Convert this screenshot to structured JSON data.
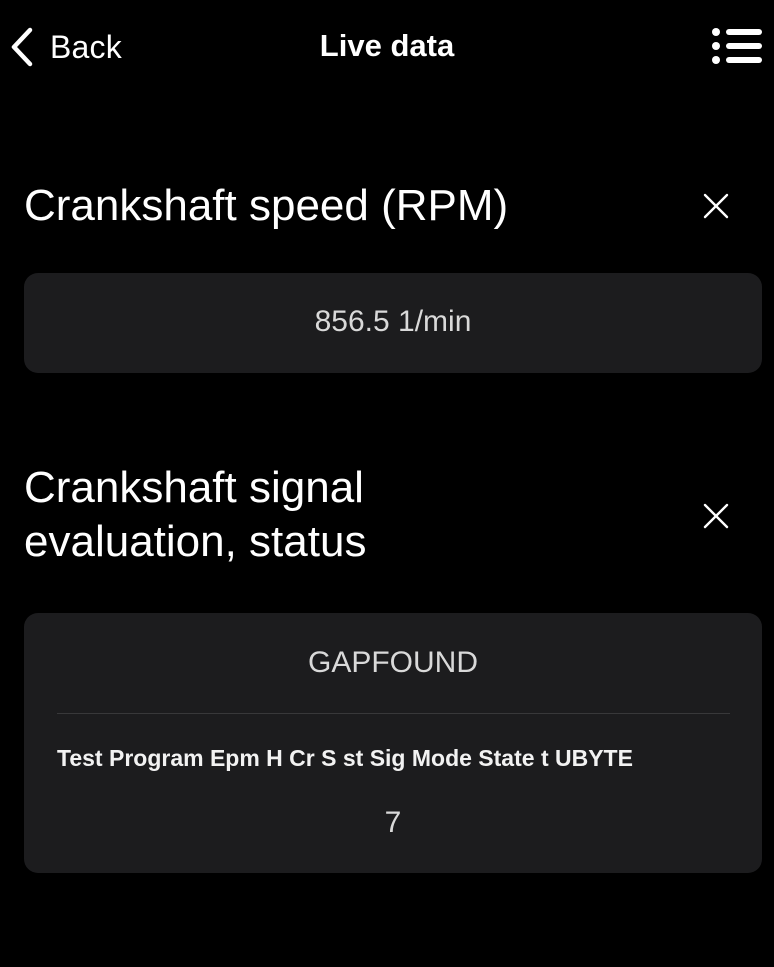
{
  "nav": {
    "back_label": "Back",
    "title": "Live data",
    "back_icon": "chevron-left-icon",
    "menu_icon": "list-icon"
  },
  "parameters": [
    {
      "title": "Crankshaft speed (RPM)",
      "remove_icon": "close-icon",
      "value": "856.5 1/min"
    },
    {
      "title_line1": "Crankshaft signal",
      "title_line2": "evaluation, status",
      "remove_icon": "close-icon",
      "value": "GAPFOUND",
      "detail_label": "Test Program Epm H Cr S st Sig Mode State t UBYTE",
      "detail_value": "7"
    }
  ],
  "colors": {
    "background": "#000000",
    "card": "#1c1c1e",
    "text": "#ffffff",
    "value_text": "#d9d9d9",
    "divider": "#38383a"
  }
}
